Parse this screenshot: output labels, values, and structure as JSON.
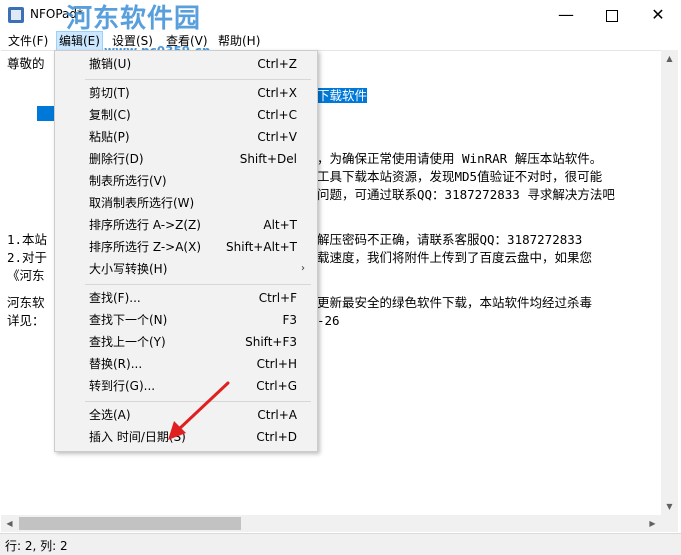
{
  "window": {
    "title": "NFOPad*",
    "watermark": "河东软件园",
    "watermark_url": "www.pc0359.cn",
    "minimize": "—",
    "close": "✕"
  },
  "menubar": [
    "文件(F)",
    "编辑(E)",
    "设置(S)",
    "查看(V)",
    "帮助(H)"
  ],
  "editor_lines": {
    "l1": "尊敬的",
    "l2_sel": "下载软件",
    "l3": "，为确保正常使用请使用 WinRAR 解压本站软件。",
    "l4": "工具下载本站资源，发现MD5值验证不对时，很可能",
    "l5": "问题，可通过联系QQ：3187272833 寻求解决方法吧",
    "l6a": "1.本站",
    "l6b": "解压密码不正确，请联系客服QQ：3187272833",
    "l7a": "2.对于",
    "l7b": "载速度，我们将附件上传到了百度云盘中，如果您",
    "l8": "《河东",
    "l9a": "河东软",
    "l9b": "更新最安全的绿色软件下载，本站软件均经过杀毒",
    "l10a": "详见：",
    "l10b": "-26"
  },
  "edit_menu": [
    {
      "label": "撤销(U)",
      "shortcut": "Ctrl+Z"
    },
    {
      "label": "剪切(T)",
      "shortcut": "Ctrl+X"
    },
    {
      "label": "复制(C)",
      "shortcut": "Ctrl+C"
    },
    {
      "label": "粘贴(P)",
      "shortcut": "Ctrl+V"
    },
    {
      "label": "删除行(D)",
      "shortcut": "Shift+Del"
    },
    {
      "label": "制表所选行(V)",
      "shortcut": ""
    },
    {
      "label": "取消制表所选行(W)",
      "shortcut": ""
    },
    {
      "label": "排序所选行 A->Z(Z)",
      "shortcut": "Alt+T"
    },
    {
      "label": "排序所选行 Z->A(X)",
      "shortcut": "Shift+Alt+T"
    },
    {
      "label": "大小写转换(H)",
      "shortcut": ""
    },
    {
      "label": "查找(F)...",
      "shortcut": "Ctrl+F"
    },
    {
      "label": "查找下一个(N)",
      "shortcut": "F3"
    },
    {
      "label": "查找上一个(Y)",
      "shortcut": "Shift+F3"
    },
    {
      "label": "替换(R)...",
      "shortcut": "Ctrl+H"
    },
    {
      "label": "转到行(G)...",
      "shortcut": "Ctrl+G"
    },
    {
      "label": "全选(A)",
      "shortcut": "Ctrl+A"
    },
    {
      "label": "插入 时间/日期(S)",
      "shortcut": "Ctrl+D"
    }
  ],
  "status": "行: 2, 列: 2",
  "colors": {
    "accent": "#0078d7",
    "annotation_arrow": "#e02020"
  }
}
